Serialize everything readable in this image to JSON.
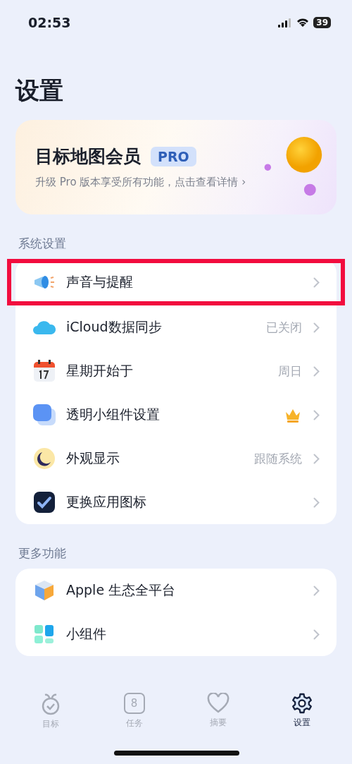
{
  "status_bar": {
    "time": "02:53",
    "battery": "39"
  },
  "title": "设置",
  "promo": {
    "title": "目标地图会员",
    "badge": "PRO",
    "subtitle": "升级 Pro 版本享受所有功能，点击查看详情",
    "arrow": "›"
  },
  "sections": [
    {
      "header": "系统设置",
      "rows": [
        {
          "label": "声音与提醒",
          "kind": "plain",
          "highlighted": true
        },
        {
          "label": "iCloud数据同步",
          "kind": "value",
          "value": "已关闭",
          "highlighted": false
        },
        {
          "label": "星期开始于",
          "kind": "value",
          "value": "周日",
          "highlighted": false
        },
        {
          "label": "透明小组件设置",
          "kind": "crown",
          "highlighted": false
        },
        {
          "label": "外观显示",
          "kind": "value",
          "value": "跟随系统",
          "highlighted": false
        },
        {
          "label": "更换应用图标",
          "kind": "plain",
          "highlighted": false
        }
      ]
    },
    {
      "header": "更多功能",
      "rows": [
        {
          "label": "Apple 生态全平台",
          "kind": "plain",
          "highlighted": false
        },
        {
          "label": "小组件",
          "kind": "plain",
          "highlighted": false
        }
      ]
    }
  ],
  "tab_bar": [
    {
      "label": "目标",
      "selected": false
    },
    {
      "label": "任务",
      "badge": "8",
      "selected": false
    },
    {
      "label": "摘要",
      "selected": false
    },
    {
      "label": "设置",
      "selected": true
    }
  ]
}
